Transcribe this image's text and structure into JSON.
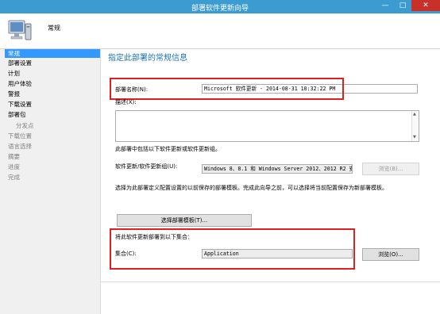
{
  "window": {
    "title": "部署软件更新向导",
    "minimize": "—",
    "maximize": "□",
    "close": "✕"
  },
  "header": {
    "title": "常规",
    "icon": "computer-icon"
  },
  "nav": {
    "items": [
      {
        "label": "常规",
        "state": "active"
      },
      {
        "label": "部署设置",
        "state": "normal"
      },
      {
        "label": "计划",
        "state": "normal"
      },
      {
        "label": "用户体验",
        "state": "normal"
      },
      {
        "label": "警报",
        "state": "normal"
      },
      {
        "label": "下载设置",
        "state": "normal"
      },
      {
        "label": "部署包",
        "state": "normal"
      },
      {
        "label": "分发点",
        "state": "sub"
      },
      {
        "label": "下载位置",
        "state": "disabled"
      },
      {
        "label": "语言选择",
        "state": "disabled"
      },
      {
        "label": "摘要",
        "state": "disabled"
      },
      {
        "label": "进度",
        "state": "disabled"
      },
      {
        "label": "完成",
        "state": "disabled"
      }
    ]
  },
  "main": {
    "title": "指定此部署的常规信息",
    "deployment_name_label": "部署名称(N):",
    "deployment_name_value": "Microsoft 软件更新 - 2014-08-31 10:32:22 PM",
    "description_label": "描述(X):",
    "description_value": "",
    "group_note": "此部署中包括以下软件更新或软件更新组。",
    "update_group_label": "软件更新/软件更新组(U):",
    "update_group_value": "Windows 8、8.1 和 Windows Server 2012、2012 R2 安全",
    "browse_label_disabled": "浏览(B)...",
    "template_note": "选择为此部署定义配置设置的以前保存的部署模板。完成此向导之前，可以选择将当前配置保存为新部署模板。",
    "template_button": "选择部署模板(T)...",
    "collection_note": "将此软件更新部署到以下集合：",
    "collection_label": "集合(C):",
    "collection_value": "Application",
    "browse_label": "浏览(O)..."
  },
  "colors": {
    "titlebar": "#3c9bd1",
    "accent_title": "#1c73b6",
    "highlight": "#e02020",
    "nav_active": "#3399ff"
  }
}
